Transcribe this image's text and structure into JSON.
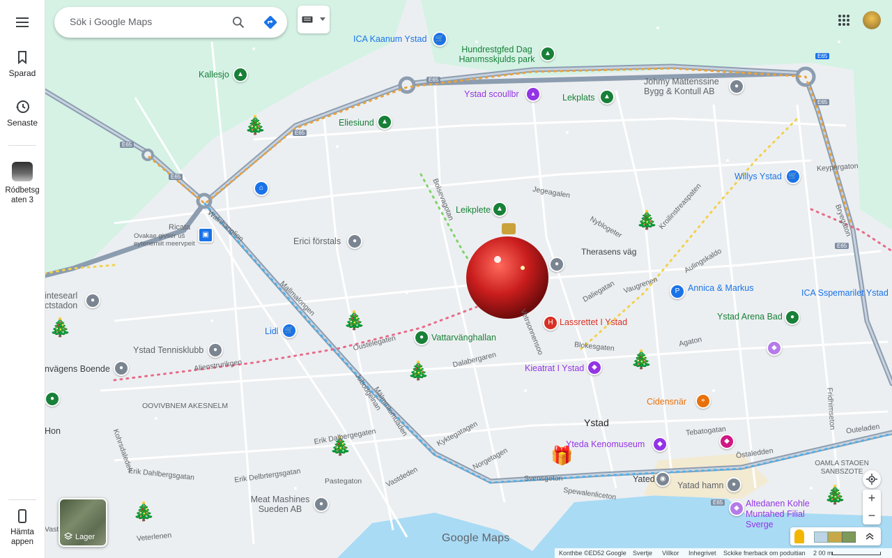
{
  "rail": {
    "menu_icon": "hamburger-icon",
    "saved_label": "Sparad",
    "recent_label": "Senaste",
    "recent_place_label": "Ródbetsg aten 3",
    "get_app_label": "Hämta appen"
  },
  "search": {
    "placeholder": "Sök i Google Maps"
  },
  "map": {
    "logo_text": "Google Maps",
    "layers_label": "Lager",
    "places": [
      {
        "name": "ICA Kaanum Ystad",
        "color": "#1a73e8"
      },
      {
        "name": "Hundrestgfed Dag Hanımsskjulds park",
        "color": "#188038"
      },
      {
        "name": "Kallesjo",
        "color": "#188038"
      },
      {
        "name": "Ystad scoullbr",
        "color": "#9334e6"
      },
      {
        "name": "Lekplats",
        "color": "#188038"
      },
      {
        "name": "Johmy Mättenssine Bygg & Kontull AB",
        "color": "#5f6368"
      },
      {
        "name": "Eliesiund",
        "color": "#188038"
      },
      {
        "name": "Willys Ystad",
        "color": "#1a73e8"
      },
      {
        "name": "Leikplete",
        "color": "#188038"
      },
      {
        "name": "Ricata",
        "color": "#5f6368"
      },
      {
        "name": "Ovakae givser uš eytenemiit meervpeit",
        "color": "#5f6368"
      },
      {
        "name": "Erici förstals",
        "color": "#5f6368"
      },
      {
        "name": "Therasens väg",
        "color": "#3c4043"
      },
      {
        "name": "Annica & Markus",
        "color": "#1a73e8"
      },
      {
        "name": "ICA Sspemarilet Ystad",
        "color": "#1a73e8"
      },
      {
        "name": "intesearl ctstadon",
        "color": "#5f6368"
      },
      {
        "name": "Lidl",
        "color": "#1a73e8"
      },
      {
        "name": "Lassrettet I Ystad",
        "color": "#d93025"
      },
      {
        "name": "Ystad Arena Bad",
        "color": "#188038"
      },
      {
        "name": "Vattarvänghallan",
        "color": "#188038"
      },
      {
        "name": "Ystad Tennisklubb",
        "color": "#5f6368"
      },
      {
        "name": "Kieatrat I Ystad",
        "color": "#9334e6"
      },
      {
        "name": "nvägens Boende",
        "color": "#3c4043"
      },
      {
        "name": "Cidensnär",
        "color": "#e8710a"
      },
      {
        "name": "Ystad",
        "color": "#202124"
      },
      {
        "name": "Yteda Kenomuseum",
        "color": "#9334e6"
      },
      {
        "name": "Meat Mashines Sueden AB",
        "color": "#5f6368"
      },
      {
        "name": "Yated",
        "color": "#3c4043"
      },
      {
        "name": "Yatad hamn",
        "color": "#5f6368"
      },
      {
        "name": "Altedanen Kohle Muntahed Filial Sverge",
        "color": "#9334e6"
      },
      {
        "name": "OAMLA STAOEN SANBSZOTE",
        "color": "#5f6368"
      },
      {
        "name": "Hon",
        "color": "#3c4043"
      }
    ],
    "streets": [
      "Bolsevagotan",
      "Jegeagalen",
      "Nyblogeter",
      "Kroilinstreaspaten",
      "Aulingskaldo",
      "Vaugrenen",
      "Agaton",
      "Dalabergaren",
      "Blokesgaten",
      "Keypergaton",
      "Bryegaton",
      "Fridhimseton",
      "Tebatogatan",
      "Östaledden",
      "Outeladen",
      "Oustelegaten",
      "Alienstrurikgen",
      "Erik Dalbergegaten",
      "Erik Dahlbergsgatan",
      "Erik Delbrtergsgatan",
      "Pastegaton",
      "Veterlenen",
      "Vastdeden",
      "Kyktegatagen",
      "Svensgeton",
      "Spewalenliceton",
      "Daliegatan",
      "Vetrsonnensoo",
      "Mallmalongen",
      "Walnhanglion",
      "Kohrsdaleden",
      "Jubodgelnan",
      "Mälmmtomuaden",
      "Vasterleden",
      "OOVIVBNEM AKESNELM",
      "Norgetagen"
    ],
    "road_shields": [
      "E65",
      "E65",
      "E65",
      "E65",
      "E65",
      "E65",
      "E65",
      "E65"
    ]
  },
  "footer": {
    "copyright": "Konthbe ©ED52 Google",
    "country": "Svertje",
    "terms": "Villkor",
    "privacy": "Inhegrivet",
    "feedback": "Sckike fnerback om poduitian",
    "scale": "2 00 m"
  },
  "colors": {
    "road": "#9aa8b8",
    "road_outline": "#7f8ea3",
    "park": "#cfeee0",
    "water": "#a9dbf5",
    "land": "#eceff1",
    "ornament": "#c91d1d"
  }
}
